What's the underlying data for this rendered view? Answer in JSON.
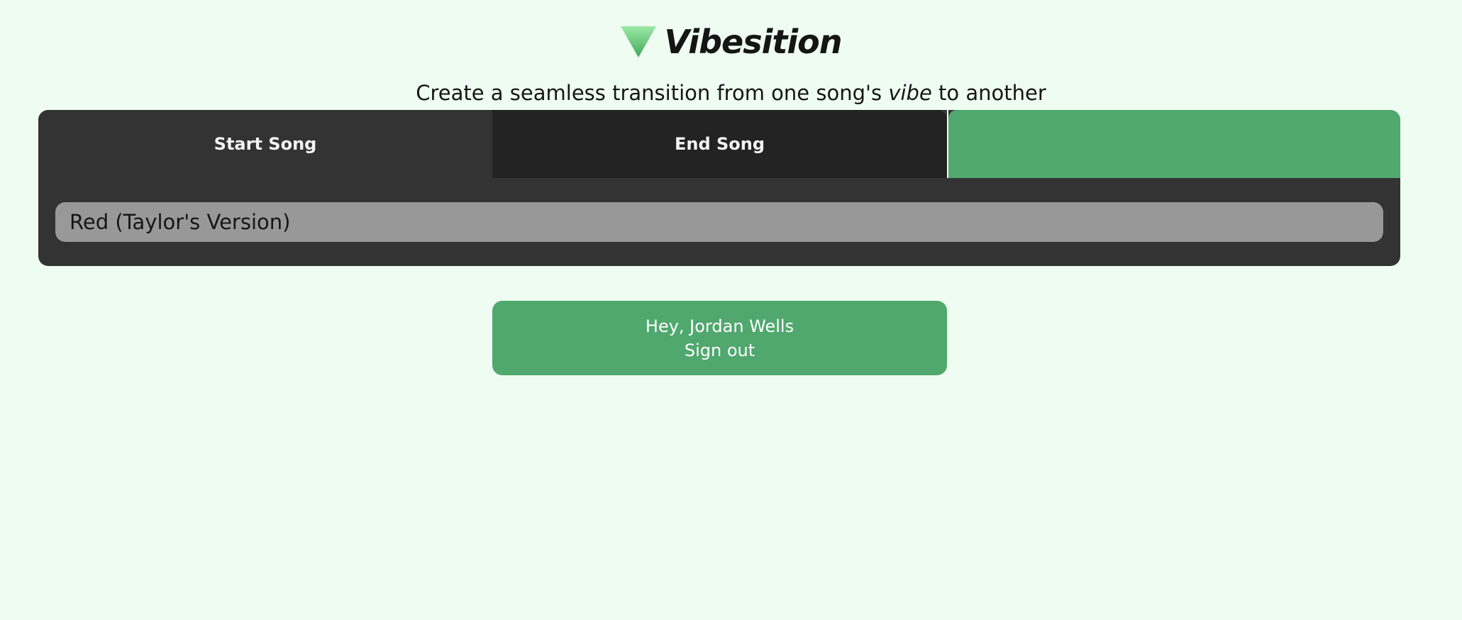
{
  "app": {
    "title": "Vibesition",
    "logo_icon": "green-triangle-down-icon"
  },
  "tagline": {
    "before": "Create a seamless transition from one song's ",
    "emphasis": "vibe",
    "after": " to another"
  },
  "tabs": [
    {
      "label": "Start Song",
      "active": true
    },
    {
      "label": "End Song",
      "active": false
    },
    {
      "label": "",
      "active": false
    }
  ],
  "search": {
    "value": "Red (Taylor's Version)",
    "placeholder": ""
  },
  "account": {
    "greeting": "Hey, Jordan Wells",
    "sign_out_label": "Sign out"
  },
  "colors": {
    "background": "#effcf2",
    "panel": "#333333",
    "inactive_tab": "#232323",
    "accent": "#50a86e",
    "input": "#989898"
  }
}
